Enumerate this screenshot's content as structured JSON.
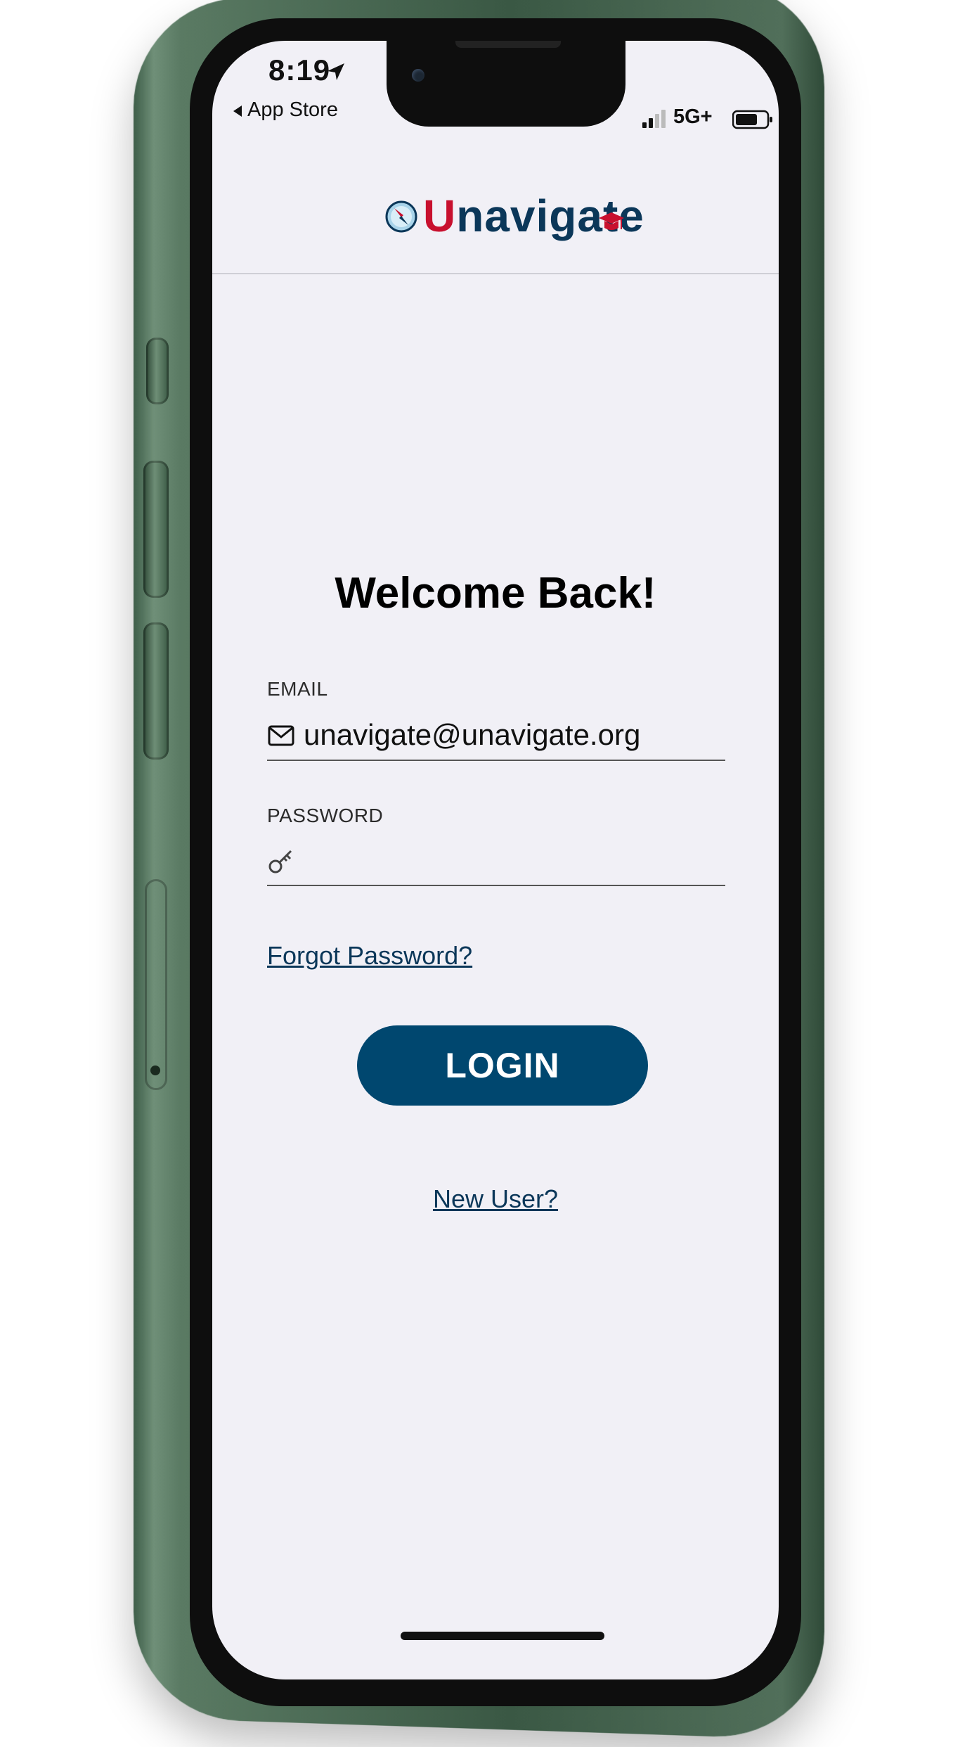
{
  "status_bar": {
    "time": "8:19",
    "back_label": "App Store",
    "network": "5G+"
  },
  "header": {
    "logo_first": "U",
    "logo_rest": "navigate"
  },
  "login": {
    "title": "Welcome Back!",
    "email_label": "EMAIL",
    "email_value": "unavigate@unavigate.org",
    "password_label": "PASSWORD",
    "password_value": "",
    "forgot_password": "Forgot Password?",
    "login_button": "LOGIN",
    "new_user": "New User?"
  },
  "colors": {
    "brand_navy": "#0b3759",
    "brand_red": "#c8102e",
    "button": "#00476f",
    "screen_bg": "#f1f0f6",
    "phone_body": "#4f6e58"
  }
}
